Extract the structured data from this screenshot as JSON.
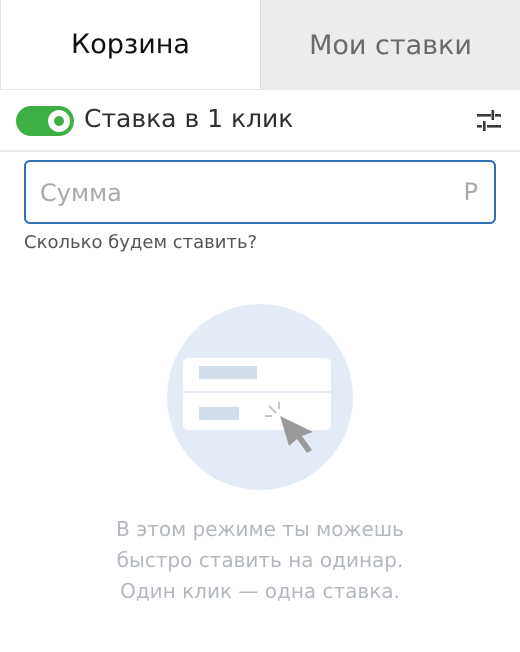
{
  "tabs": [
    {
      "label": "Корзина",
      "active": true
    },
    {
      "label": "Мои ставки",
      "active": false
    }
  ],
  "one_click": {
    "label": "Ставка в 1 клик",
    "enabled": true
  },
  "amount": {
    "placeholder": "Сумма",
    "value": "",
    "currency": "Р",
    "hint": "Сколько будем ставить?"
  },
  "empty_state": {
    "lines": [
      "В этом режиме ты можешь",
      "быстро ставить на одинар.",
      "Один клик — одна ставка."
    ]
  },
  "colors": {
    "accent_green": "#3cb043",
    "input_border": "#2f6fb3",
    "illustration_bg": "#e3ecf6"
  }
}
